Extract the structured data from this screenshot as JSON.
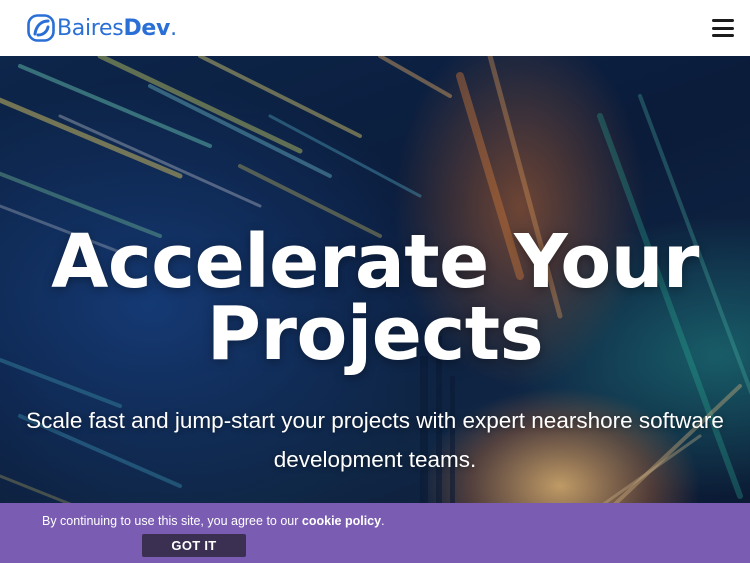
{
  "header": {
    "logo_prefix": "Baires",
    "logo_bold": "Dev",
    "logo_dot": ".",
    "menu_icon": "hamburger-menu-icon"
  },
  "hero": {
    "title_line1": "Accelerate Your",
    "title_line2": "Projects",
    "subtitle": "Scale fast and jump-start your projects with expert nearshore software development teams."
  },
  "cookie": {
    "text": "By continuing to use this site, you agree to our ",
    "link": "cookie policy",
    "suffix": ".",
    "button": "GOT IT"
  },
  "colors": {
    "brand_blue": "#2a6fd6",
    "cookie_bar": "#7a5cb2",
    "cookie_button": "#3b2f52"
  }
}
